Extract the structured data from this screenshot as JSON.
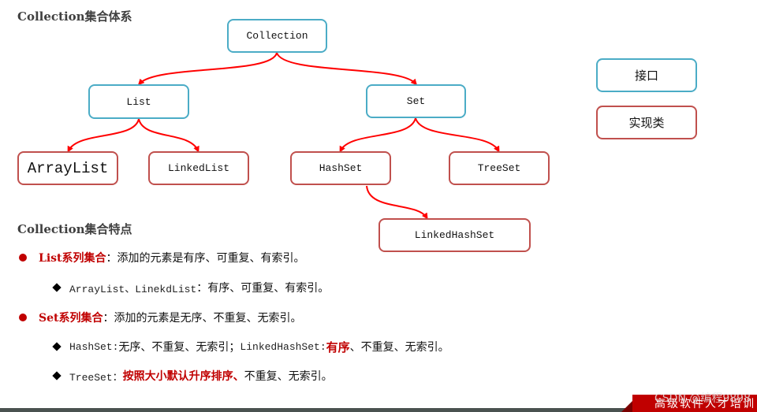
{
  "hierarchy_section": {
    "title": "Collection集合体系"
  },
  "diagram": {
    "nodes": {
      "collection": {
        "label": "Collection",
        "kind": "interface"
      },
      "list": {
        "label": "List",
        "kind": "interface"
      },
      "set": {
        "label": "Set",
        "kind": "interface"
      },
      "arraylist": {
        "label": "ArrayList",
        "kind": "class"
      },
      "linkedlist": {
        "label": "LinkedList",
        "kind": "class"
      },
      "hashset": {
        "label": "HashSet",
        "kind": "class"
      },
      "treeset": {
        "label": "TreeSet",
        "kind": "class"
      },
      "linkedhashset": {
        "label": "LinkedHashSet",
        "kind": "class"
      }
    },
    "edges": [
      [
        "collection",
        "list"
      ],
      [
        "collection",
        "set"
      ],
      [
        "list",
        "arraylist"
      ],
      [
        "list",
        "linkedlist"
      ],
      [
        "set",
        "hashset"
      ],
      [
        "set",
        "treeset"
      ],
      [
        "hashset",
        "linkedhashset"
      ]
    ],
    "colors": {
      "interface_border": "#4bacc6",
      "class_border": "#c0504d",
      "arrow": "#ff0000"
    }
  },
  "legend": {
    "interface_label": "接口",
    "class_label": "实现类"
  },
  "features_section": {
    "title": "Collection集合特点",
    "list_bullet": {
      "highlight": "List系列集合",
      "text": "：添加的元素是有序、可重复、有索引。"
    },
    "list_sub": {
      "code": "ArrayList、LinekdList ",
      "text": "：有序、可重复、有索引。"
    },
    "set_bullet": {
      "highlight": "Set系列集合",
      "text": "：添加的元素是无序、不重复、无索引。"
    },
    "set_sub1": {
      "code1": "HashSet: ",
      "text1": "无序、不重复、无索引；",
      "code2": "LinkedHashSet: ",
      "highlight": "有序",
      "text2": "、不重复、无索引。"
    },
    "set_sub2": {
      "code": "TreeSet：",
      "highlight": "按照大小默认升序排序、",
      "text": "不重复、无索引。"
    },
    "accent_color": "#c00000"
  },
  "footer": {
    "banner_text": "高级软件人才培训",
    "watermark": "CSDN @编程9898"
  }
}
